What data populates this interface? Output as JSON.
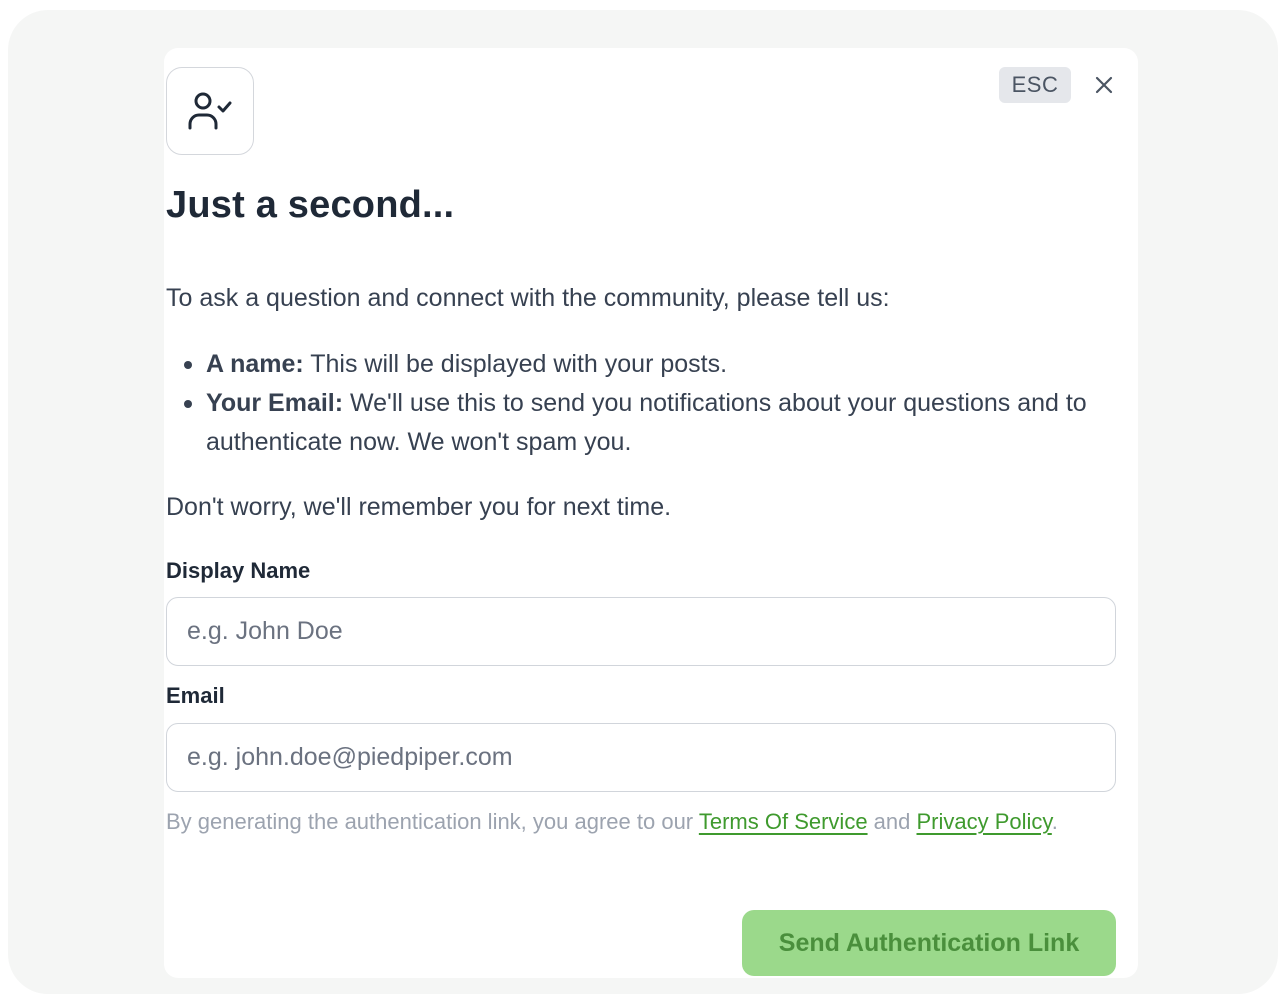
{
  "dialog": {
    "icon": "user-check-icon",
    "esc_label": "ESC",
    "close_icon": "close-icon",
    "title": "Just a second...",
    "intro": "To ask a question and connect with the community, please tell us:",
    "bullets": [
      {
        "term": "A name:",
        "text": " This will be displayed with your posts."
      },
      {
        "term": "Your Email:",
        "text": " We'll use this to send you notifications about your questions and to authenticate now. We won't spam you."
      }
    ],
    "remember": "Don't worry, we'll remember you for next time."
  },
  "form": {
    "name_label": "Display Name",
    "name_placeholder": "e.g. John Doe",
    "name_value": "",
    "email_label": "Email",
    "email_placeholder": "e.g. john.doe@piedpiper.com",
    "email_value": ""
  },
  "legal": {
    "prefix": "By generating the authentication link, you agree to our ",
    "terms_link": "Terms Of Service",
    "middle": " and ",
    "privacy_link": "Privacy Policy",
    "suffix": "."
  },
  "actions": {
    "send_label": "Send Authentication Link"
  },
  "colors": {
    "accent": "#3f9a2e",
    "button_bg_disabled": "#9bd98b",
    "button_text_disabled": "#4a8f3c",
    "title_text": "#1f2937",
    "body_text": "#374151"
  }
}
